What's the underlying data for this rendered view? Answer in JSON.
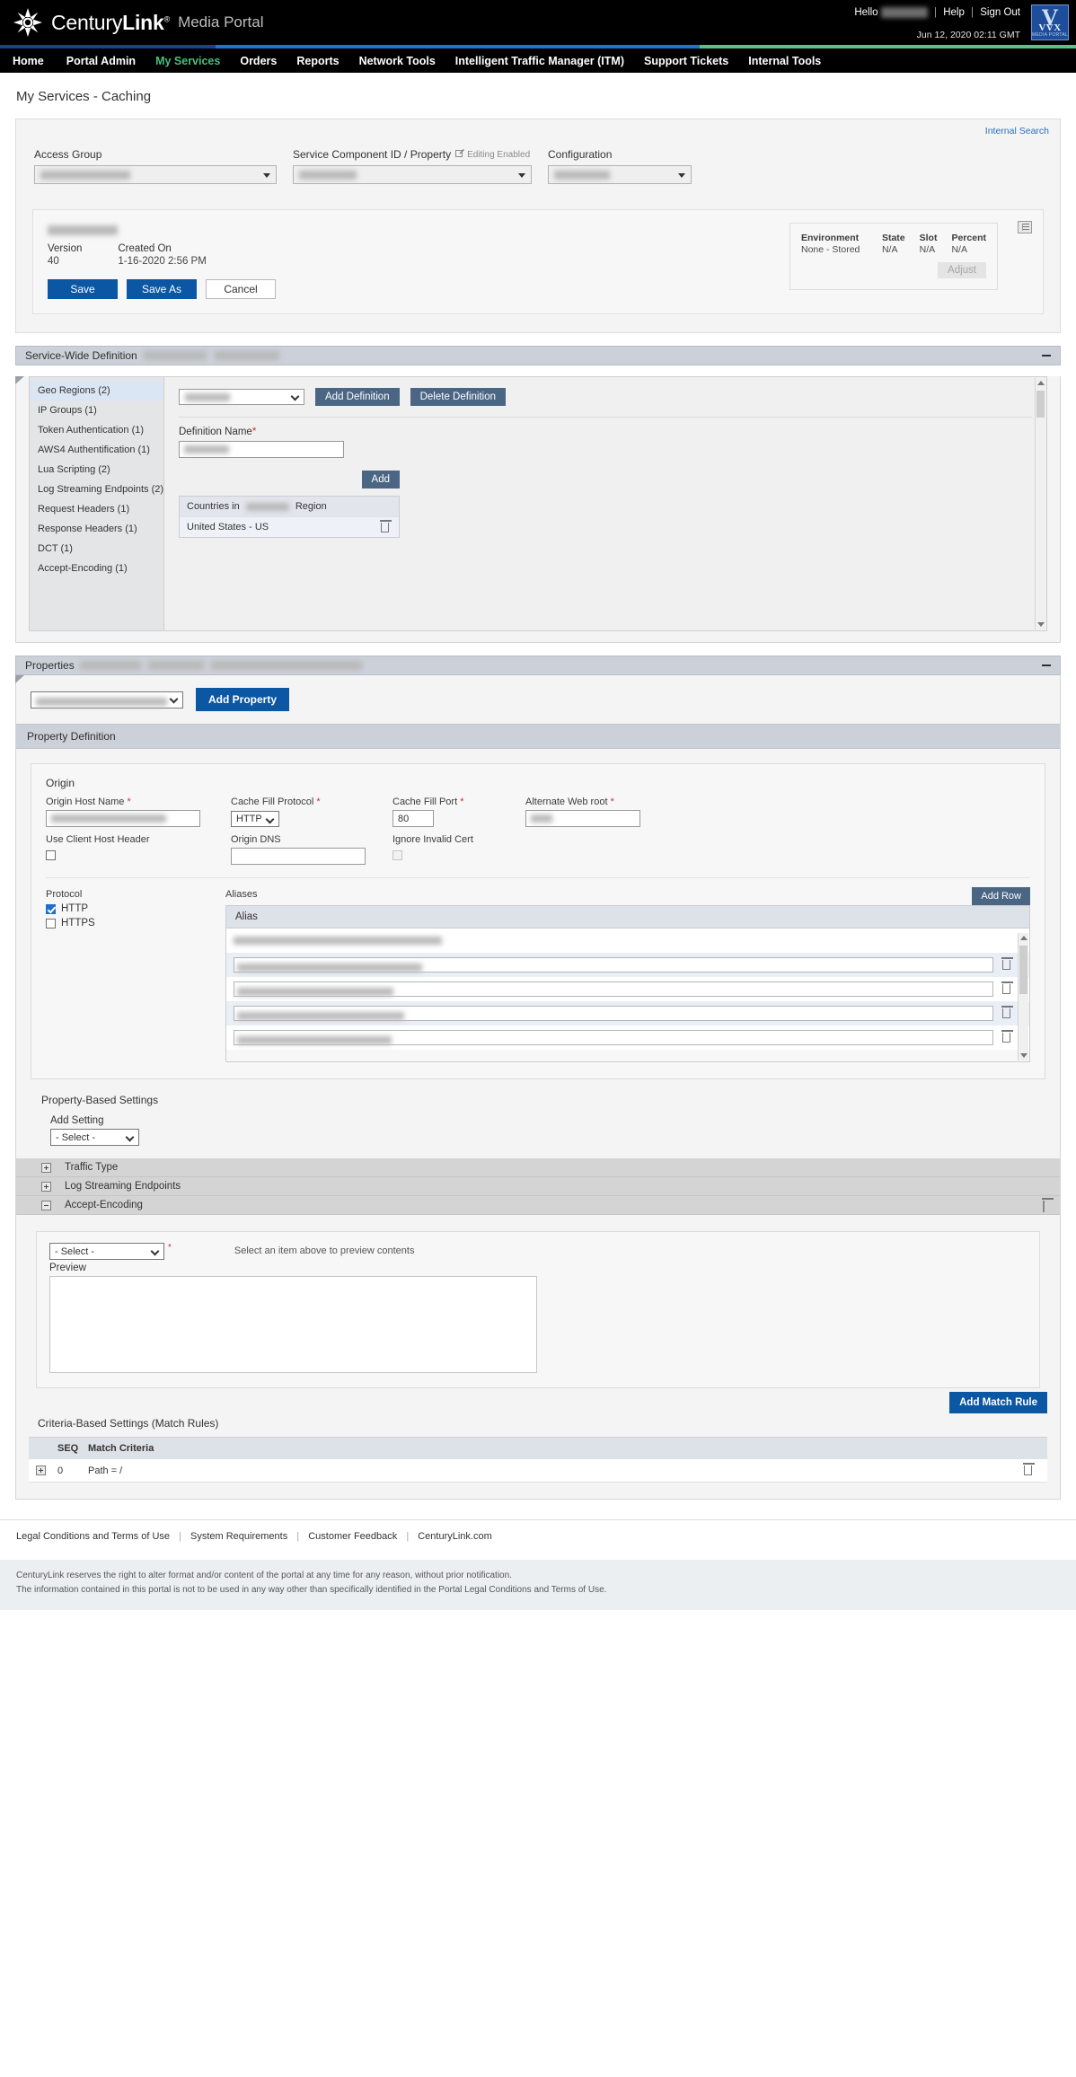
{
  "header": {
    "brand_name_part1": "Century",
    "brand_name_part2": "Link",
    "brand_reg": "®",
    "product": "Media Portal",
    "hello": "Hello",
    "user_redacted": "         ",
    "help": "Help",
    "sign_out": "Sign Out",
    "datetime": "Jun 12, 2020 02:11 GMT",
    "badge": {
      "line1": "V",
      "line2": "VVX",
      "line3": "MEDIA PORTAL"
    },
    "stripe_colors": [
      "#1d3f8f",
      "#1976d2",
      "#5cc08a"
    ]
  },
  "nav": {
    "items": [
      {
        "label": "Home",
        "active": false
      },
      {
        "label": "Portal Admin",
        "active": false
      },
      {
        "label": "My Services",
        "active": true
      },
      {
        "label": "Orders",
        "active": false
      },
      {
        "label": "Reports",
        "active": false
      },
      {
        "label": "Network Tools",
        "active": false
      },
      {
        "label": "Intelligent Traffic Manager (ITM)",
        "active": false
      },
      {
        "label": "Support Tickets",
        "active": false
      },
      {
        "label": "Internal Tools",
        "active": false
      }
    ]
  },
  "page": {
    "title": "My Services - Caching",
    "internal_search": "Internal Search"
  },
  "selectors": {
    "access_group": {
      "label": "Access Group",
      "value_redacted": "             "
    },
    "service_component": {
      "label": "Service Component ID / Property",
      "editing_flag": "Editing Enabled",
      "value_redacted": "         "
    },
    "configuration": {
      "label": "Configuration",
      "value_redacted": "        "
    }
  },
  "version_card": {
    "config_name_redacted": "           ",
    "version_label": "Version",
    "version_value": "40",
    "created_label": "Created On",
    "created_value": "1-16-2020 2:56 PM",
    "save": "Save",
    "save_as": "Save As",
    "cancel": "Cancel",
    "environment": {
      "env_label": "Environment",
      "env_value": "None - Stored",
      "state_label": "State",
      "state_value": "N/A",
      "slot_label": "Slot",
      "slot_value": "N/A",
      "percent_label": "Percent",
      "percent_value": "N/A",
      "adjust": "Adjust"
    }
  },
  "service_wide": {
    "title": "Service-Wide Definition",
    "title_redacted_1": "         ",
    "title_redacted_2": "         ",
    "list": [
      {
        "label": "Geo Regions (2)",
        "selected": true
      },
      {
        "label": "IP Groups (1)",
        "selected": false
      },
      {
        "label": "Token Authentication (1)",
        "selected": false
      },
      {
        "label": "AWS4 Authentification (1)",
        "selected": false
      },
      {
        "label": "Lua Scripting (2)",
        "selected": false
      },
      {
        "label": "Log Streaming Endpoints (2)",
        "selected": false
      },
      {
        "label": "Request Headers (1)",
        "selected": false
      },
      {
        "label": "Response Headers (1)",
        "selected": false
      },
      {
        "label": "DCT (1)",
        "selected": false
      },
      {
        "label": "Accept-Encoding (1)",
        "selected": false
      }
    ],
    "definition_select_redacted": "       ",
    "add_definition": "Add Definition",
    "delete_definition": "Delete Definition",
    "definition_name_label": "Definition Name",
    "definition_name_value_redacted": "       ",
    "add": "Add",
    "countries_header_pre": "Countries in",
    "countries_header_redacted": "       ",
    "countries_header_post": "Region",
    "countries": [
      "United States - US"
    ]
  },
  "properties": {
    "title": "Properties",
    "title_redacted_1": "        ",
    "title_redacted_2": "        ",
    "title_redacted_3": "                    ",
    "property_select_redacted": "                   ",
    "add_property": "Add Property",
    "property_definition": "Property Definition",
    "origin": {
      "section_title": "Origin",
      "origin_host_name_label": "Origin Host Name",
      "origin_host_name_value_redacted": "                ",
      "cache_fill_protocol_label": "Cache Fill Protocol",
      "cache_fill_protocol_value": "HTTP",
      "cache_fill_port_label": "Cache Fill Port",
      "cache_fill_port_value": "80",
      "alternate_web_root_label": "Alternate Web root",
      "alternate_web_root_value_redacted": "     ",
      "use_client_host_header_label": "Use Client Host Header",
      "use_client_host_header_checked": false,
      "origin_dns_label": "Origin DNS",
      "origin_dns_value": "",
      "ignore_invalid_cert_label": "Ignore Invalid Cert",
      "ignore_invalid_cert_checked": false
    },
    "protocol": {
      "label": "Protocol",
      "options": [
        {
          "label": "HTTP",
          "checked": true
        },
        {
          "label": "HTTPS",
          "checked": false
        }
      ]
    },
    "aliases": {
      "label": "Aliases",
      "add_row": "Add Row",
      "column": "Alias",
      "rows": [
        {
          "value_redacted": "                         ",
          "primary": true,
          "editable": false
        },
        {
          "value_redacted": "                      ",
          "primary": false,
          "editable": true
        },
        {
          "value_redacted": "                  ",
          "primary": false,
          "editable": true
        },
        {
          "value_redacted": "                   ",
          "primary": false,
          "editable": true
        },
        {
          "value_redacted": "                  ",
          "primary": false,
          "editable": true
        }
      ]
    }
  },
  "property_based_settings": {
    "title": "Property-Based Settings",
    "add_setting_label": "Add Setting",
    "add_setting_value": "- Select -",
    "rows": [
      {
        "label": "Traffic Type",
        "expanded": false,
        "deletable": false
      },
      {
        "label": "Log Streaming Endpoints",
        "expanded": false,
        "deletable": false
      },
      {
        "label": "Accept-Encoding",
        "expanded": true,
        "deletable": true
      }
    ],
    "preview": {
      "select_value": "- Select -",
      "hint": "Select an item above to preview contents",
      "label": "Preview",
      "content": ""
    }
  },
  "criteria": {
    "add_match_rule": "Add Match Rule",
    "title": "Criteria-Based Settings (Match Rules)",
    "columns": [
      "SEQ",
      "Match Criteria"
    ],
    "rows": [
      {
        "seq": "0",
        "match_criteria": "Path = /"
      }
    ]
  },
  "footer": {
    "links": [
      "Legal Conditions and Terms of Use",
      "System Requirements",
      "Customer Feedback",
      "CenturyLink.com"
    ],
    "note_line1": "CenturyLink reserves the right to alter format and/or content of the portal at any time for any reason, without prior notification.",
    "note_line2": "The information contained in this portal is not to be used in any way other than specifically identified in the Portal Legal Conditions and Terms of Use."
  }
}
